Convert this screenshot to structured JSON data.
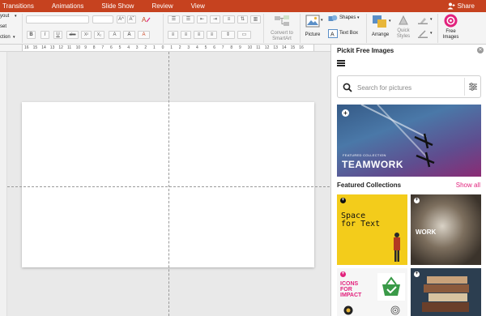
{
  "menu": {
    "tabs": [
      "Transitions",
      "Animations",
      "Slide Show",
      "Review",
      "View"
    ],
    "share": "Share"
  },
  "ribbon": {
    "layout_label": "yout",
    "reset_label": "set",
    "section_label": "ction",
    "bold": "B",
    "italic": "I",
    "underline": "U",
    "strike": "abc",
    "superscript": "X²",
    "subscript": "X₂",
    "grow_font": "A^",
    "shrink_font": "Aˇ",
    "convert_smartart": [
      "Convert to",
      "SmartArt"
    ],
    "picture": "Picture",
    "shapes": "Shapes",
    "text_box": "Text Box",
    "arrange": "Arrange",
    "quick_styles": [
      "Quick",
      "Styles"
    ],
    "free_images": [
      "Free",
      "Images"
    ]
  },
  "ruler": {
    "numbers": [
      "16",
      "15",
      "14",
      "13",
      "12",
      "11",
      "10",
      "9",
      "8",
      "7",
      "6",
      "5",
      "4",
      "3",
      "2",
      "1",
      "0",
      "1",
      "2",
      "3",
      "4",
      "5",
      "6",
      "7",
      "8",
      "9",
      "10",
      "11",
      "12",
      "13",
      "14",
      "15",
      "16"
    ]
  },
  "panel": {
    "title": "Pickit Free Images",
    "search_placeholder": "Search for pictures",
    "hero_label": "FEATURED COLLECTION",
    "hero_title": "TEAMWORK",
    "featured_title": "Featured Collections",
    "show_all": "Show all",
    "tiles": [
      {
        "text": "Space\nfor Text"
      },
      {
        "text": "WORK"
      },
      {
        "text": "ICONS\nFOR\nIMPACT"
      },
      {
        "text": ""
      }
    ]
  },
  "colors": {
    "brand_orange": "#c6421f",
    "accent_pink": "#e2227d",
    "yellow_tile": "#f3cc1b"
  }
}
